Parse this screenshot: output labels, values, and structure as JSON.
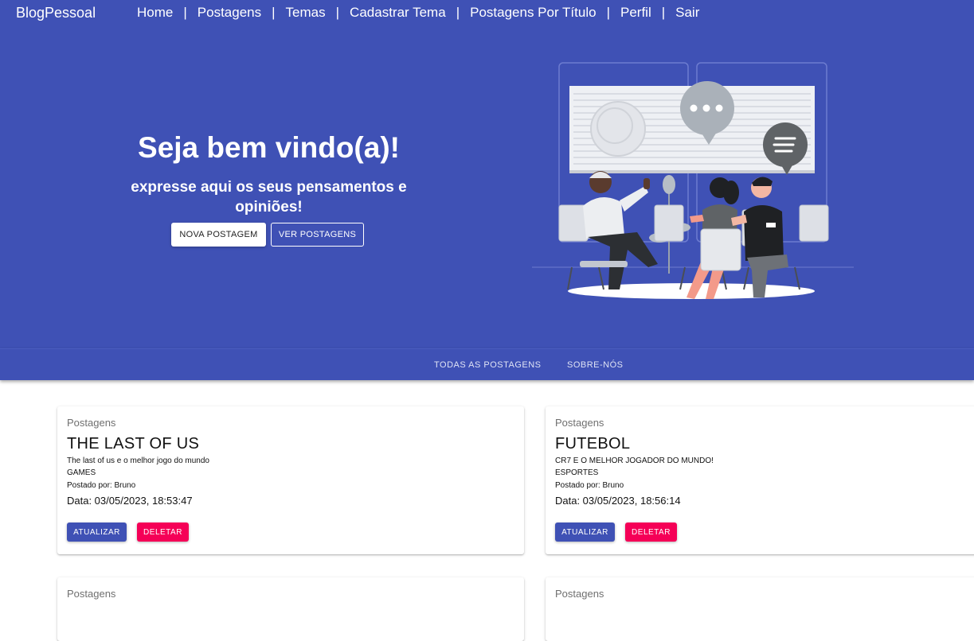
{
  "app": {
    "brand": "BlogPessoal"
  },
  "nav": {
    "items": [
      "Home",
      "Postagens",
      "Temas",
      "Cadastrar Tema",
      "Postagens Por Título",
      "Perfil",
      "Sair"
    ],
    "separator": "|"
  },
  "hero": {
    "title": "Seja bem vindo(a)!",
    "subtitle": "expresse aqui os seus pensamentos e opiniões!",
    "new_post_label": "NOVA POSTAGEM",
    "view_posts_label": "VER POSTAGENS",
    "illustration": "people-chatting-illustration"
  },
  "tabs": [
    "TODAS AS POSTAGENS",
    "SOBRE-NÓS"
  ],
  "posts": [
    {
      "label": "Postagens",
      "title": "THE LAST OF US",
      "text": "The last of us e o melhor jogo do mundo",
      "theme": "GAMES",
      "author": "Postado por: Bruno",
      "date": "Data: 03/05/2023, 18:53:47",
      "update_label": "ATUALIZAR",
      "delete_label": "DELETAR"
    },
    {
      "label": "Postagens",
      "title": "FUTEBOL",
      "text": "CR7 E O MELHOR JOGADOR DO MUNDO!",
      "theme": "ESPORTES",
      "author": "Postado por: Bruno",
      "date": "Data: 03/05/2023, 18:56:14",
      "update_label": "ATUALIZAR",
      "delete_label": "DELETAR"
    },
    {
      "label": "Postagens"
    },
    {
      "label": "Postagens"
    }
  ],
  "colors": {
    "primary": "#3f51b5",
    "danger": "#f50057"
  }
}
